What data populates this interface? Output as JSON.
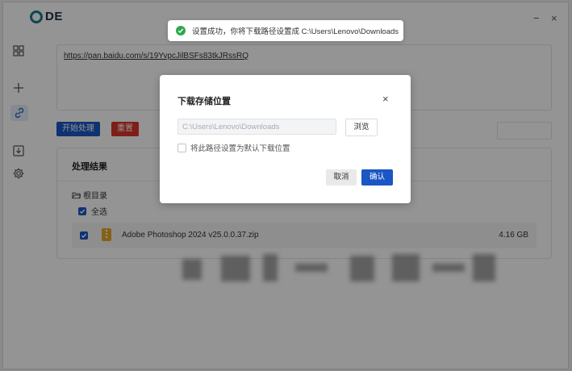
{
  "app": {
    "logo_text": "DE"
  },
  "window_controls": {
    "minimize": "−",
    "close": "×"
  },
  "sidebar": {
    "items": [
      {
        "icon": "grid-icon"
      },
      {
        "icon": "plus-icon"
      },
      {
        "icon": "link-icon",
        "active": true
      },
      {
        "icon": "download-icon"
      },
      {
        "icon": "gear-icon"
      }
    ]
  },
  "main": {
    "url": "https://pan.baidu.com/s/19YvpcJilBSFs83tkJRssRQ",
    "start_button": "开始处理",
    "reset_button": "重置",
    "results": {
      "title": "处理结果",
      "root_label": "根目录",
      "select_all_label": "全选",
      "file": {
        "name": "Adobe Photoshop 2024 v25.0.0.37.zip",
        "size": "4.16 GB",
        "checked": true
      }
    }
  },
  "dialog": {
    "title": "下载存储位置",
    "path_value": "C:\\Users\\Lenovo\\Downloads",
    "browse_button": "浏览",
    "default_checkbox_label": "将此路径设置为默认下载位置",
    "cancel_button": "取消",
    "confirm_button": "确认"
  },
  "toast": {
    "message": "设置成功，你将下载路径设置成 C:\\Users\\Lenovo\\Downloads",
    "status_color": "#2fa84f"
  },
  "colors": {
    "primary": "#1a56c4",
    "danger": "#d9342b",
    "brand": "#1a7a8a"
  }
}
